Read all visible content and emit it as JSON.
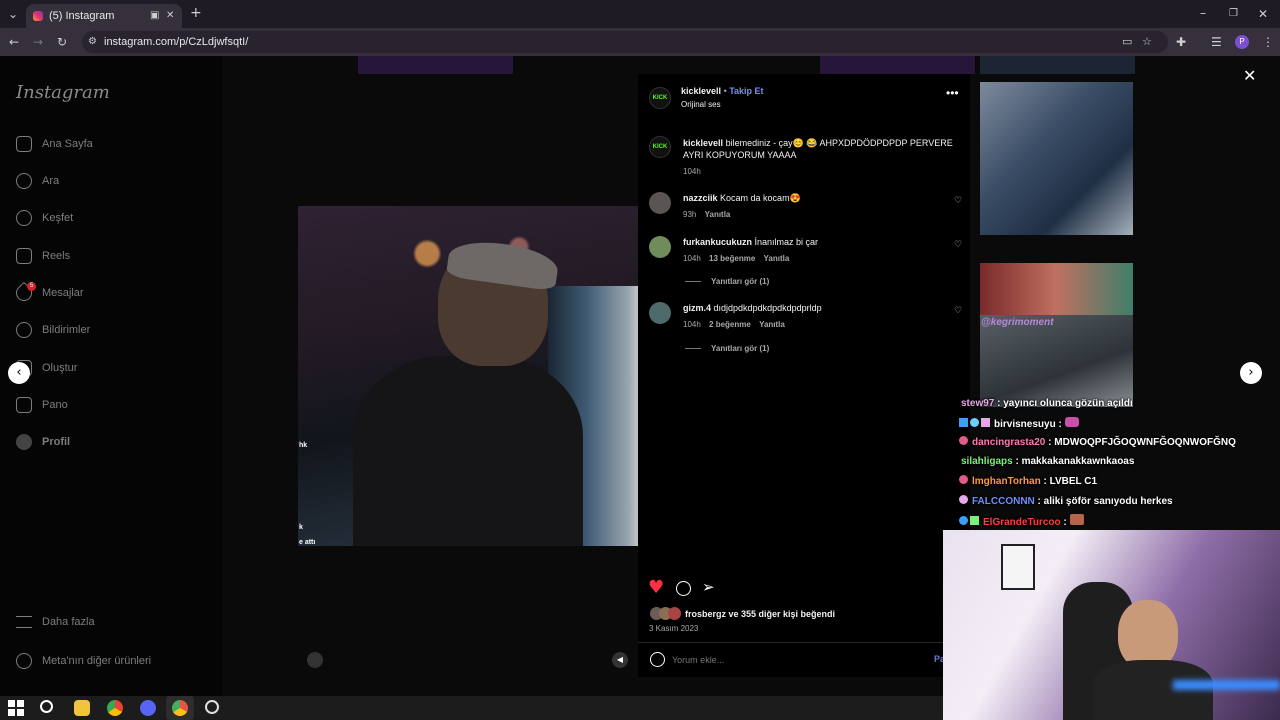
{
  "browser": {
    "tab_title": "(5) Instagram",
    "url": "instagram.com/p/CzLdjwfsqtI/",
    "new_tab": "+"
  },
  "sidebar": {
    "logo": "Instagram",
    "items": [
      {
        "label": "Ana Sayfa"
      },
      {
        "label": "Ara"
      },
      {
        "label": "Keşfet"
      },
      {
        "label": "Reels"
      },
      {
        "label": "Mesajlar"
      },
      {
        "label": "Bildirimler"
      },
      {
        "label": "Oluştur"
      },
      {
        "label": "Pano"
      },
      {
        "label": "Profil"
      }
    ],
    "messages_badge": "5",
    "more": "Daha fazla",
    "meta": "Meta'nın diğer ürünleri"
  },
  "post": {
    "username": "kicklevell",
    "follow": "Takip Et",
    "audio": "Orijinal ses",
    "caption_user": "kicklevell",
    "caption_text1": "bilemediniz - çay😊 😂 AHPXDPDÖDPDPDP PERVERE",
    "caption_text2": "AYRI KOPUYORUM YAAAA",
    "caption_time": "104h",
    "comments": [
      {
        "user": "nazzciik",
        "text": "Kocam da kocam😍",
        "time": "93h",
        "likes": "",
        "reply": "Yanıtla"
      },
      {
        "user": "furkankucukuzn",
        "text": "İnanılmaz bi çar",
        "time": "104h",
        "likes": "13 beğenme",
        "reply": "Yanıtla",
        "view_replies": "Yanıtları gör (1)"
      },
      {
        "user": "gizm.4",
        "text": "dıdjdpdkdpdkdpdkdpdprldp",
        "time": "104h",
        "likes": "2 beğenme",
        "reply": "Yanıtla",
        "view_replies": "Yanıtları gör (1)"
      }
    ],
    "liked_by": "frosbergz ve 355 diğer kişi beğendi",
    "date": "3 Kasım 2023",
    "comment_placeholder": "Yorum ekle...",
    "post_button": "Pa"
  },
  "overlay": {
    "watermark": "@kegrimoment",
    "chat": [
      {
        "user": "stew97",
        "msg": " : yayıncı olunca gözün açıldı",
        "color": "#e6a7e6"
      },
      {
        "user": "birvisnesuyu",
        "msg": " : ",
        "color": "#ffffff"
      },
      {
        "user": "dancingrasta20",
        "msg": " : MDWOQPFJĞOQWNFĞOQNWOFĞNQ",
        "color": "#ff7ab6"
      },
      {
        "user": "silahligaps",
        "msg": " : makkakanakkawnkaoas",
        "color": "#7cf07c"
      },
      {
        "user": "lmghanTorhan",
        "msg": " : LVBEL C1",
        "color": "#ff9a3d"
      },
      {
        "user": "FALCCONNN",
        "msg": " : aliki şöför sanıyodu herkes",
        "color": "#6f8dff"
      },
      {
        "user": "ElGrandeTurcoo",
        "msg": " : ",
        "color": "#ff3e3e"
      }
    ]
  },
  "colors": {
    "like": "#ff3040",
    "follow": "#7b8cff",
    "kick": "#53fc18"
  }
}
